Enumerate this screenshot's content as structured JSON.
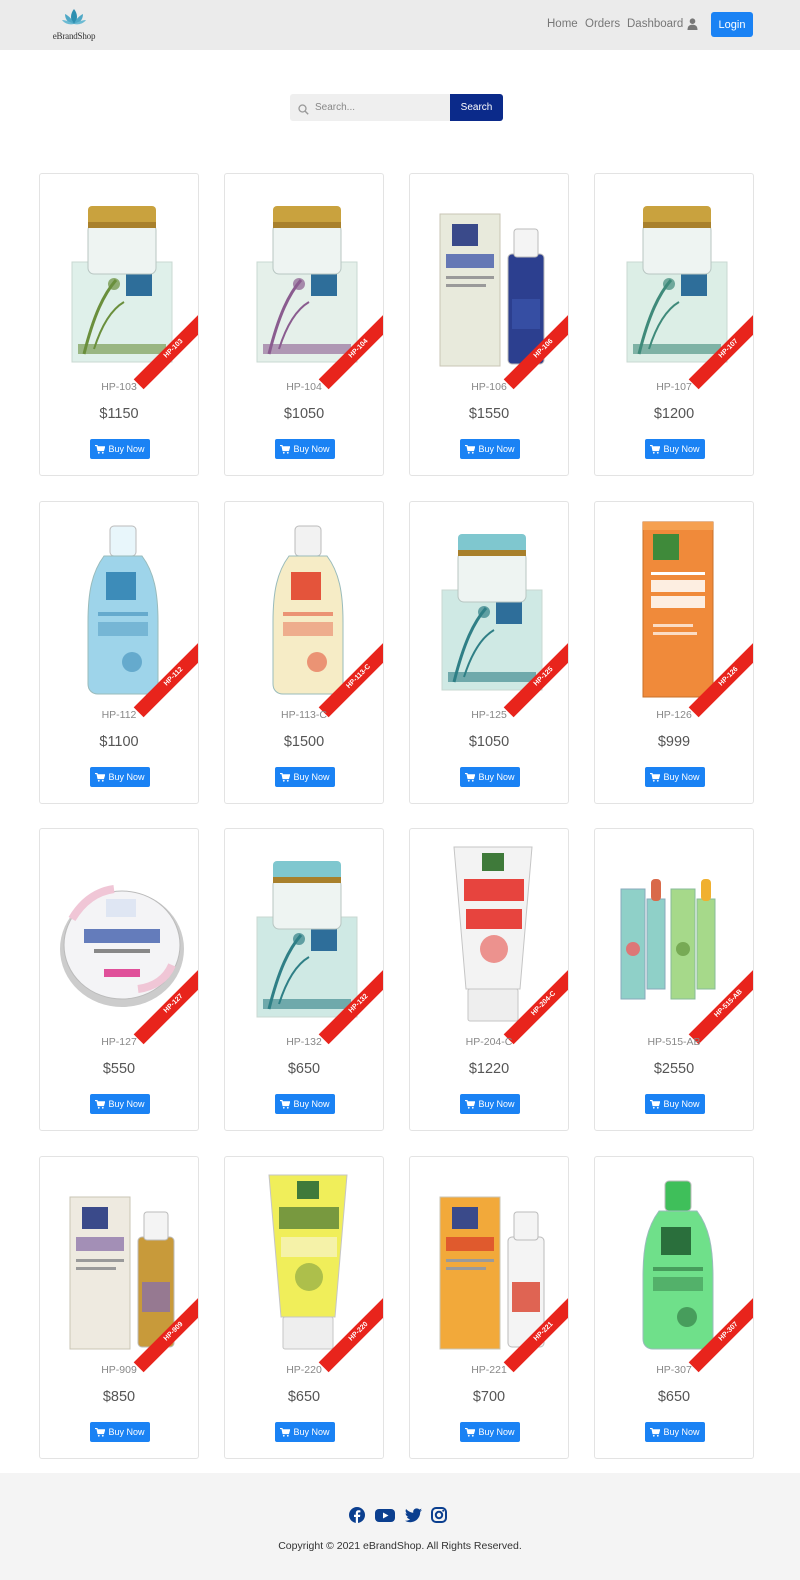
{
  "navbar": {
    "brand": "eBrandShop",
    "links": [
      "Home",
      "Orders",
      "Dashboard"
    ],
    "login_label": "Login"
  },
  "search": {
    "placeholder": "Search...",
    "button_label": "Search"
  },
  "products": [
    {
      "sku": "HP-103",
      "price": "$1150",
      "tag": "HP-103",
      "kind": "jar",
      "jar": "#dff0ea",
      "lid": "#c9a23e",
      "accent": "#6a8f3c",
      "buy": "Buy Now"
    },
    {
      "sku": "HP-104",
      "price": "$1050",
      "tag": "HP-104",
      "kind": "jar",
      "jar": "#e5f0ea",
      "lid": "#c9a23e",
      "accent": "#8a5c8f",
      "buy": "Buy Now"
    },
    {
      "sku": "HP-106",
      "price": "$1550",
      "tag": "HP-106",
      "kind": "box-bottle",
      "jar": "#e8eadc",
      "lid": "#2c3f8f",
      "accent": "#3a52a8",
      "buy": "Buy Now"
    },
    {
      "sku": "HP-107",
      "price": "$1200",
      "tag": "HP-107",
      "kind": "jar",
      "jar": "#dceee6",
      "lid": "#c9a23e",
      "accent": "#3f8a7a",
      "buy": "Buy Now"
    },
    {
      "sku": "HP-112",
      "price": "$1100",
      "tag": "HP-112",
      "kind": "bottle",
      "jar": "#9ed4ea",
      "lid": "#e8f6fb",
      "accent": "#2c7fb0",
      "buy": "Buy Now"
    },
    {
      "sku": "HP-113-C",
      "price": "$1500",
      "tag": "HP-113-C",
      "kind": "bottle",
      "jar": "#f6ecc6",
      "lid": "#f2f2f2",
      "accent": "#e03a22",
      "buy": "Buy Now"
    },
    {
      "sku": "HP-125",
      "price": "$1050",
      "tag": "HP-125",
      "kind": "jar",
      "jar": "#cfe9e4",
      "lid": "#7fc7cf",
      "accent": "#2f7f86",
      "buy": "Buy Now"
    },
    {
      "sku": "HP-126",
      "price": "$999",
      "tag": "HP-126",
      "kind": "tallbox",
      "jar": "#f08a3a",
      "lid": "#f5a050",
      "accent": "#ffffff",
      "buy": "Buy Now"
    },
    {
      "sku": "HP-127",
      "price": "$550",
      "tag": "HP-127",
      "kind": "tin",
      "jar": "#f4f4f6",
      "lid": "#f0c6d6",
      "accent": "#4a66b0",
      "buy": "Buy Now"
    },
    {
      "sku": "HP-132",
      "price": "$650",
      "tag": "HP-132",
      "kind": "jar",
      "jar": "#cfe9e4",
      "lid": "#7fc7cf",
      "accent": "#2f7f86",
      "buy": "Buy Now"
    },
    {
      "sku": "HP-204-C",
      "price": "$1220",
      "tag": "HP-204-C",
      "kind": "tube",
      "jar": "#f3f3f3",
      "lid": "#e5312a",
      "accent": "#e5312a",
      "buy": "Buy Now"
    },
    {
      "sku": "HP-515-AB",
      "price": "$2550",
      "tag": "HP-515-AB",
      "kind": "lipsticks",
      "jar": "#8fd0c8",
      "lid": "#a6d98a",
      "accent": "#d96a4a",
      "buy": "Buy Now"
    },
    {
      "sku": "HP-909",
      "price": "$850",
      "tag": "HP-909",
      "kind": "box-bottle",
      "jar": "#eeeae0",
      "lid": "#c89a3a",
      "accent": "#8a70a8",
      "buy": "Buy Now"
    },
    {
      "sku": "HP-220",
      "price": "$650",
      "tag": "HP-220",
      "kind": "tube",
      "jar": "#f0ee5a",
      "lid": "#f5f2b0",
      "accent": "#6a8f3c",
      "buy": "Buy Now"
    },
    {
      "sku": "HP-221",
      "price": "$700",
      "tag": "HP-221",
      "kind": "box-bottle",
      "jar": "#f2a93a",
      "lid": "#f4f4f4",
      "accent": "#d9402a",
      "buy": "Buy Now"
    },
    {
      "sku": "HP-307",
      "price": "$650",
      "tag": "HP-307",
      "kind": "bottle",
      "jar": "#6fe08a",
      "lid": "#3fbf5a",
      "accent": "#1f5a2e",
      "buy": "Buy Now"
    }
  ],
  "footer": {
    "social": [
      "facebook",
      "youtube",
      "twitter",
      "instagram"
    ],
    "copyright": "Copyright © 2021 eBrandShop. All Rights Reserved."
  }
}
